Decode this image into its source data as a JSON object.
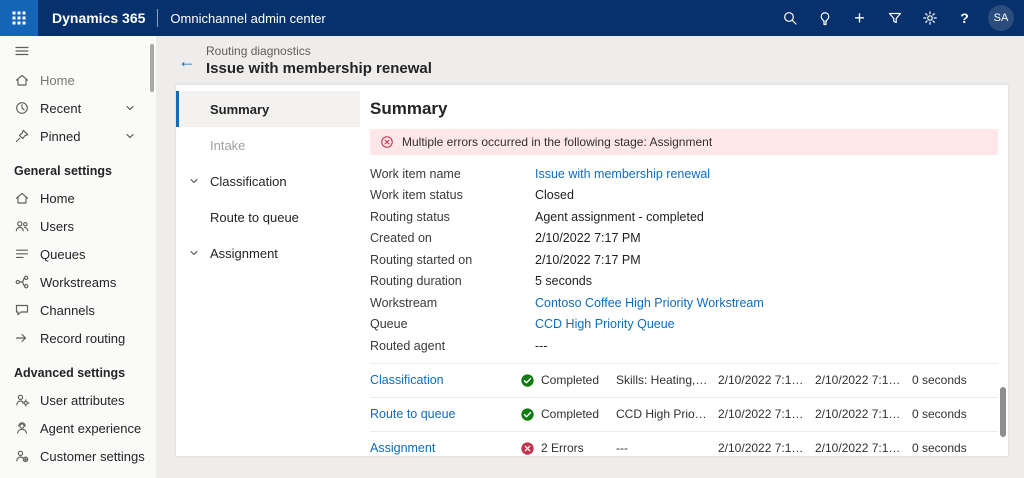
{
  "topbar": {
    "brand": "Dynamics 365",
    "app_name": "Omnichannel admin center",
    "avatar_initials": "SA"
  },
  "icons": {
    "add": "+",
    "help": "?",
    "back_arrow": "←"
  },
  "sidebar": {
    "top_items": [
      {
        "label": "Home"
      },
      {
        "label": "Recent"
      },
      {
        "label": "Pinned"
      }
    ],
    "sections": [
      {
        "header": "General settings",
        "items": [
          "Home",
          "Users",
          "Queues",
          "Workstreams",
          "Channels",
          "Record routing"
        ]
      },
      {
        "header": "Advanced settings",
        "items": [
          "User attributes",
          "Agent experience",
          "Customer settings"
        ]
      }
    ]
  },
  "breadcrumb": {
    "section": "Routing diagnostics",
    "title": "Issue with membership renewal"
  },
  "subnav": {
    "items": [
      {
        "label": "Summary",
        "state": "selected"
      },
      {
        "label": "Intake",
        "state": "disabled"
      },
      {
        "label": "Classification",
        "state": "normal"
      },
      {
        "label": "Route to queue",
        "state": "normal"
      },
      {
        "label": "Assignment",
        "state": "normal"
      }
    ]
  },
  "summary": {
    "heading": "Summary",
    "error_banner": "Multiple errors occurred in the following stage: Assignment",
    "fields": [
      {
        "label": "Work item name",
        "value": "Issue with membership renewal",
        "kind": "link"
      },
      {
        "label": "Work item status",
        "value": "Closed",
        "kind": "text"
      },
      {
        "label": "Routing status",
        "value": "Agent assignment - completed",
        "kind": "text"
      },
      {
        "label": "Created on",
        "value": "2/10/2022 7:17 PM",
        "kind": "text"
      },
      {
        "label": "Routing started on",
        "value": "2/10/2022 7:17 PM",
        "kind": "text"
      },
      {
        "label": "Routing duration",
        "value": "5 seconds",
        "kind": "text"
      },
      {
        "label": "Workstream",
        "value": "Contoso Coffee High Priority Workstream",
        "kind": "link"
      },
      {
        "label": "Queue",
        "value": "CCD High Priority Queue",
        "kind": "link"
      },
      {
        "label": "Routed agent",
        "value": "---",
        "kind": "text"
      }
    ],
    "stages": [
      {
        "name": "Classification",
        "status": "Completed",
        "status_kind": "success",
        "detail": "Skills: Heating,…",
        "started": "2/10/2022 7:1…",
        "completed": "2/10/2022 7:1…",
        "duration": "0 seconds"
      },
      {
        "name": "Route to queue",
        "status": "Completed",
        "status_kind": "success",
        "detail": "CCD High Prio…",
        "started": "2/10/2022 7:1…",
        "completed": "2/10/2022 7:1…",
        "duration": "0 seconds"
      },
      {
        "name": "Assignment",
        "status": "2 Errors",
        "status_kind": "error",
        "detail": "---",
        "started": "2/10/2022 7:1…",
        "completed": "2/10/2022 7:1…",
        "duration": "0 seconds"
      }
    ]
  },
  "colors": {
    "topbar_bg": "#07316d",
    "waffle_bg": "#1464b8",
    "accent_blue": "#0f6cbd",
    "link_blue": "#0f6cbd",
    "error_red": "#c4314b",
    "success_green": "#107c10",
    "banner_bg": "#fde7e9"
  }
}
